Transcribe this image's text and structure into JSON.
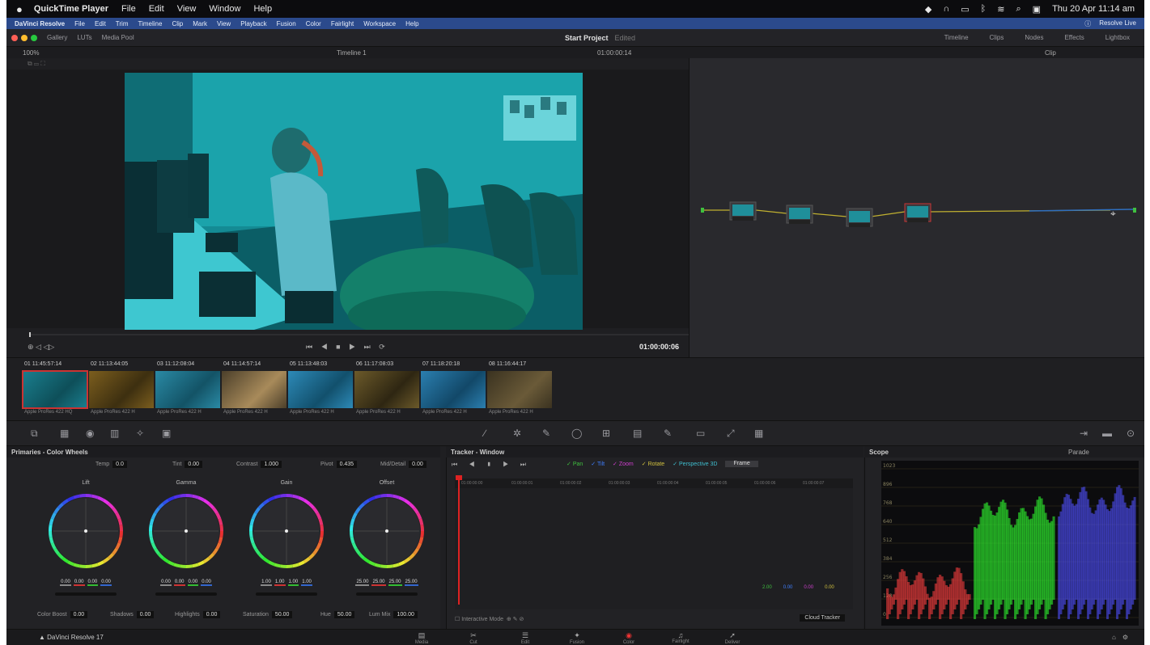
{
  "mac_menu": {
    "apple": "",
    "app_name": "QuickTime Player",
    "items": [
      "File",
      "Edit",
      "View",
      "Window",
      "Help"
    ],
    "clock": "Thu 20 Apr  11:14 am"
  },
  "resolve_menu": {
    "items": [
      "DaVinci Resolve",
      "File",
      "Edit",
      "Trim",
      "Timeline",
      "Clip",
      "Mark",
      "View",
      "Playback",
      "Fusion",
      "Color",
      "Fairlight",
      "Workspace",
      "Help"
    ],
    "right": "Resolve Live"
  },
  "toolbar": {
    "left_buttons": [
      "Gallery",
      "LUTs",
      "Media Pool"
    ],
    "project_title": "Start Project",
    "project_state": "Edited",
    "right_buttons": [
      "Timeline",
      "Clips",
      "Nodes",
      "Effects",
      "Lightbox"
    ]
  },
  "viewer": {
    "zoom": "100%",
    "timeline_name": "Timeline 1",
    "timecode_top": "01:00:00:14",
    "timecode": "01:00:00:06",
    "transport": "⏮ ◀ ■ ▶ ⏭ ⟳"
  },
  "node_header": {
    "mode": "Clip"
  },
  "clips": [
    {
      "num": "01",
      "tc": "11:45:57:14",
      "name": "Apple ProRes 422 HQ",
      "sel": true
    },
    {
      "num": "02",
      "tc": "11:13:44:05",
      "name": "Apple ProRes 422 H"
    },
    {
      "num": "03",
      "tc": "11:12:08:04",
      "name": "Apple ProRes 422 H"
    },
    {
      "num": "04",
      "tc": "11:14:57:14",
      "name": "Apple ProRes 422 H"
    },
    {
      "num": "05",
      "tc": "11:13:48:03",
      "name": "Apple ProRes 422 H"
    },
    {
      "num": "06",
      "tc": "11:17:08:03",
      "name": "Apple ProRes 422 H"
    },
    {
      "num": "07",
      "tc": "11:18:20:18",
      "name": "Apple ProRes 422 H"
    },
    {
      "num": "08",
      "tc": "11:16:44:17",
      "name": "Apple ProRes 422 H"
    }
  ],
  "primaries": {
    "title": "Primaries - Color Wheels",
    "top_fields": [
      {
        "label": "Temp",
        "value": "0.0"
      },
      {
        "label": "Tint",
        "value": "0.00"
      },
      {
        "label": "Contrast",
        "value": "1.000"
      },
      {
        "label": "Pivot",
        "value": "0.435"
      },
      {
        "label": "Mid/Detail",
        "value": "0.00"
      }
    ],
    "wheels": [
      {
        "label": "Lift",
        "values": [
          "0.00",
          "0.00",
          "0.00",
          "0.00"
        ]
      },
      {
        "label": "Gamma",
        "values": [
          "0.00",
          "0.00",
          "0.00",
          "0.00"
        ]
      },
      {
        "label": "Gain",
        "values": [
          "1.00",
          "1.00",
          "1.00",
          "1.00"
        ]
      },
      {
        "label": "Offset",
        "values": [
          "25.00",
          "25.00",
          "25.00",
          "25.00"
        ]
      }
    ],
    "bottom_fields": [
      {
        "label": "Color Boost",
        "value": "0.00"
      },
      {
        "label": "Shadows",
        "value": "0.00"
      },
      {
        "label": "Highlights",
        "value": "0.00"
      },
      {
        "label": "Saturation",
        "value": "50.00"
      },
      {
        "label": "Hue",
        "value": "50.00"
      },
      {
        "label": "Lum Mix",
        "value": "100.00"
      }
    ]
  },
  "tracker": {
    "title": "Tracker - Window",
    "tools": "⏮ ◀ ▮ ▶ ⏭",
    "checks": [
      {
        "label": "Pan",
        "color": "#3fbf3f"
      },
      {
        "label": "Tilt",
        "color": "#3f7fff"
      },
      {
        "label": "Zoom",
        "color": "#d03fd0"
      },
      {
        "label": "Rotate",
        "color": "#d0c03f"
      },
      {
        "label": "Perspective 3D",
        "color": "#3fbfd0"
      }
    ],
    "frame_btn": "Frame",
    "ruler": [
      "01:00:00:00",
      "01:00:00:01",
      "01:00:00:02",
      "01:00:00:03",
      "01:00:00:04",
      "01:00:00:05",
      "01:00:00:06",
      "01:00:00:07"
    ],
    "legend": [
      {
        "label": "2.00",
        "color": "#3fbf3f"
      },
      {
        "label": "0.00",
        "color": "#3f7fff"
      },
      {
        "label": "0.00",
        "color": "#d03fd0"
      },
      {
        "label": "0.00",
        "color": "#d0c03f"
      }
    ],
    "bottom_left": "Interactive Mode",
    "bottom_right": "Cloud Tracker"
  },
  "scope": {
    "title": "Scope",
    "mode": "Parade",
    "scale": [
      "1023",
      "896",
      "768",
      "640",
      "512",
      "384",
      "256",
      "128",
      "0"
    ]
  },
  "page_tabs": [
    {
      "label": "Media",
      "icon": "▤"
    },
    {
      "label": "Cut",
      "icon": "✂"
    },
    {
      "label": "Edit",
      "icon": "☰"
    },
    {
      "label": "Fusion",
      "icon": "✦"
    },
    {
      "label": "Color",
      "icon": "◉",
      "active": true
    },
    {
      "label": "Fairlight",
      "icon": "♫"
    },
    {
      "label": "Deliver",
      "icon": "➚"
    }
  ],
  "brand": "DaVinci Resolve 17",
  "colors": {
    "accent_red": "#cc2222",
    "menubar_blue": "#2b4a8c",
    "node_edge": "#c0b030",
    "video_tint": "#158a93"
  }
}
